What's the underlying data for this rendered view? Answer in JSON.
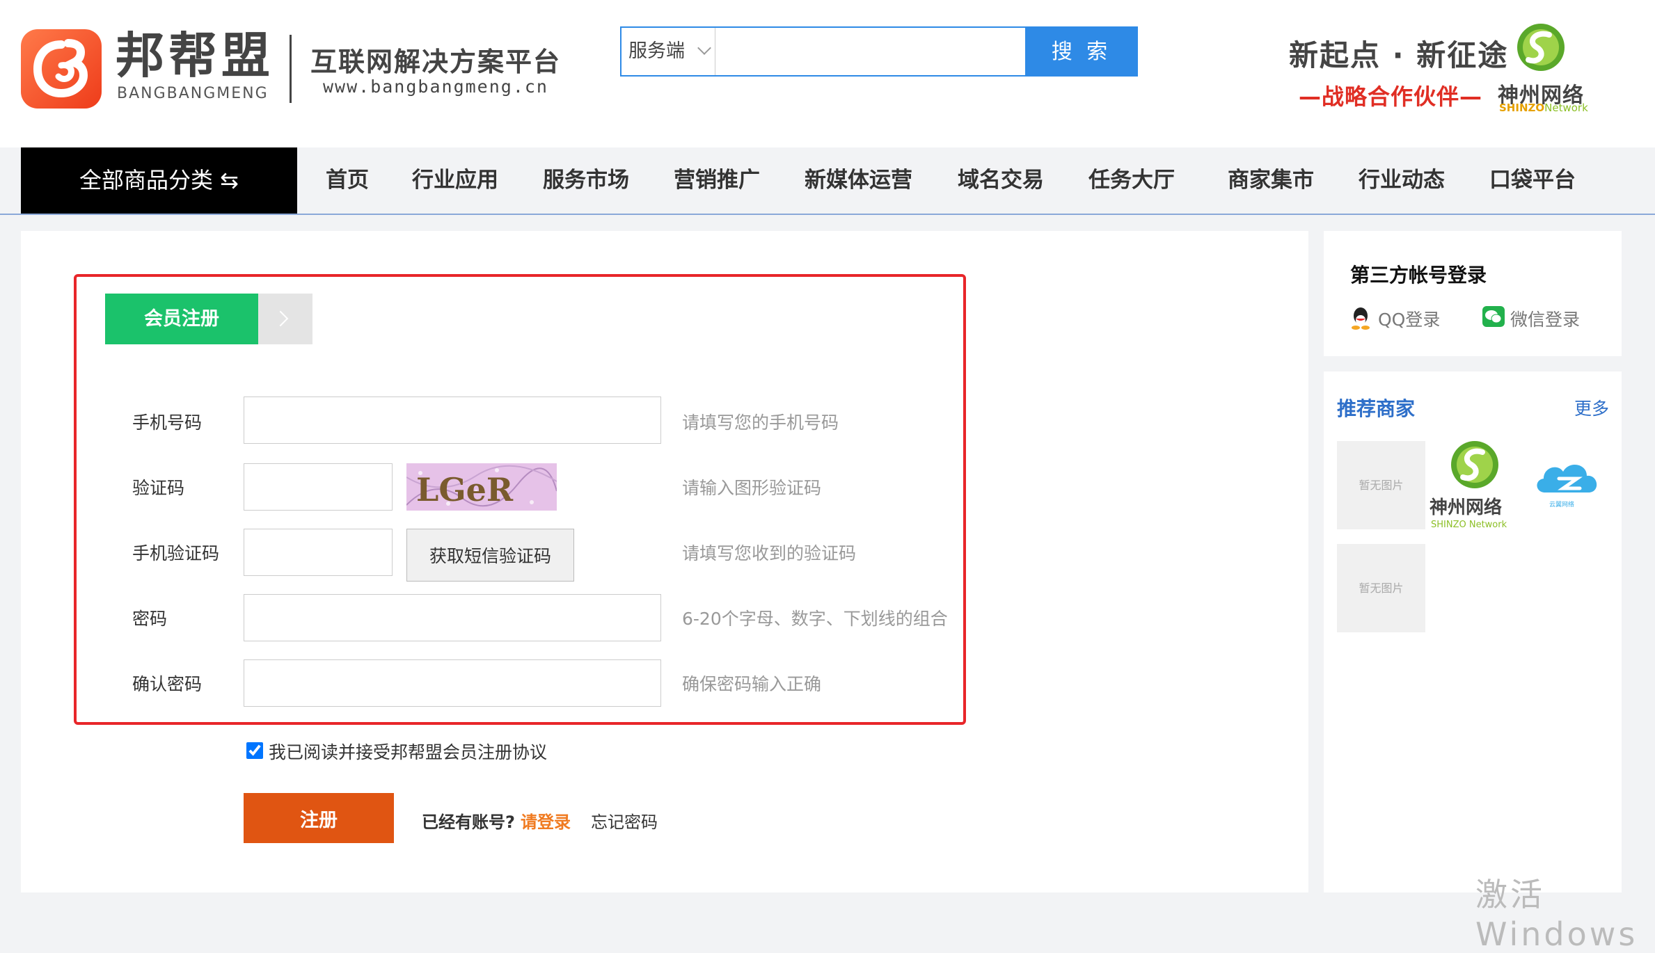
{
  "header": {
    "logo_text": "邦帮盟",
    "logo_en": "BANGBANGMENG",
    "slogan": "互联网解决方案平台",
    "url": "www.bangbangmeng.cn",
    "search": {
      "category": "服务端",
      "button_label": "搜 索",
      "placeholder": ""
    },
    "partner": {
      "title": "新起点 · 新征途",
      "subtitle": "—战略合作伙伴—",
      "name": "神州网络",
      "name_en_prefix": "SHINZO",
      "name_en_suffix": "Network"
    }
  },
  "nav": {
    "all_categories": "全部商品分类 ⇆",
    "items": [
      "首页",
      "行业应用",
      "服务市场",
      "营销推广",
      "新媒体运营",
      "域名交易",
      "任务大厅",
      "商家集市",
      "行业动态",
      "口袋平台"
    ]
  },
  "register": {
    "tab_label": "会员注册",
    "fields": [
      {
        "label": "手机号码",
        "hint": "请填写您的手机号码",
        "value": ""
      },
      {
        "label": "验证码",
        "hint": "请输入图形验证码",
        "value": ""
      },
      {
        "label": "手机验证码",
        "hint": "请填写您收到的验证码",
        "value": ""
      },
      {
        "label": "密码",
        "hint": "6-20个字母、数字、下划线的组合",
        "value": ""
      },
      {
        "label": "确认密码",
        "hint": "确保密码输入正确",
        "value": ""
      }
    ],
    "captcha_text": "LGeR",
    "sms_button": "获取短信验证码",
    "agree_text": "我已阅读并接受邦帮盟会员注册协议",
    "agree_checked": true,
    "submit_label": "注册",
    "has_account": "已经有账号?",
    "login_link": "请登录",
    "forgot_link": "忘记密码"
  },
  "sidebar": {
    "third_party_title": "第三方帐号登录",
    "qq_label": "QQ登录",
    "wechat_label": "微信登录",
    "recommend_title": "推荐商家",
    "more_label": "更多",
    "no_image": "暂无图片",
    "merchant_shinzo": "神州网络",
    "merchant_shinzo_en": "SHINZO Network",
    "merchant_cloud": "云翼网络"
  },
  "watermark": "激活 Windows",
  "colors": {
    "accent_blue": "#2e8ae6",
    "green": "#1bc26b",
    "orange": "#e05512",
    "red_frame": "#e8262a",
    "link_orange": "#f07b21"
  }
}
